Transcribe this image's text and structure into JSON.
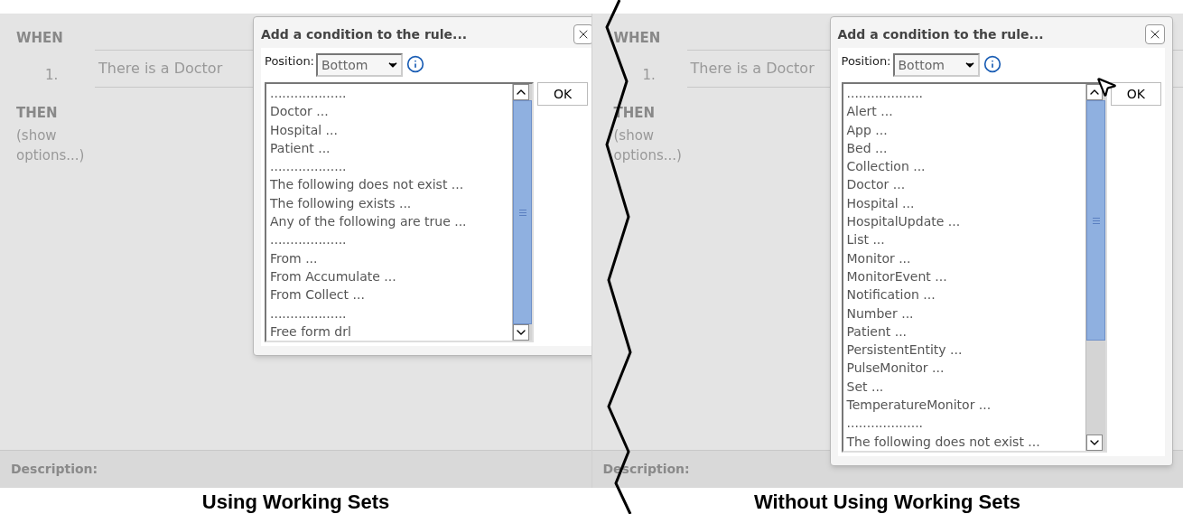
{
  "panels": [
    {
      "when_label": "WHEN",
      "rule_number": "1.",
      "rule_text": "There is a Doctor",
      "then_label": "THEN",
      "show_options": "(show options...)",
      "description_label": "Description:",
      "cursor": false,
      "caption": "Using Working Sets",
      "dialog": {
        "title": "Add a condition to the rule...",
        "position_label": "Position:",
        "position_value": "Bottom",
        "ok": "OK",
        "items": [
          "...................",
          "Doctor ...",
          "Hospital ...",
          "Patient ...",
          "...................",
          "The following does not exist ...",
          "The following exists ...",
          "Any of the following are true ...",
          "...................",
          "From ...",
          "From Accumulate ...",
          "From Collect ...",
          "...................",
          "Free form drl"
        ]
      }
    },
    {
      "when_label": "WHEN",
      "rule_number": "1.",
      "rule_text": "There is a Doctor",
      "then_label": "THEN",
      "show_options": "(show options...)",
      "description_label": "Description:",
      "cursor": true,
      "caption": "Without Using Working Sets",
      "dialog": {
        "title": "Add a condition to the rule...",
        "position_label": "Position:",
        "position_value": "Bottom",
        "ok": "OK",
        "items": [
          "...................",
          "Alert ...",
          "App ...",
          "Bed ...",
          "Collection ...",
          "Doctor ...",
          "Hospital ...",
          "HospitalUpdate ...",
          "List ...",
          "Monitor ...",
          "MonitorEvent ...",
          "Notification ...",
          "Number ...",
          "Patient ...",
          "PersistentEntity ...",
          "PulseMonitor ...",
          "Set ...",
          "TemperatureMonitor ...",
          "...................",
          "The following does not exist ..."
        ]
      }
    }
  ]
}
